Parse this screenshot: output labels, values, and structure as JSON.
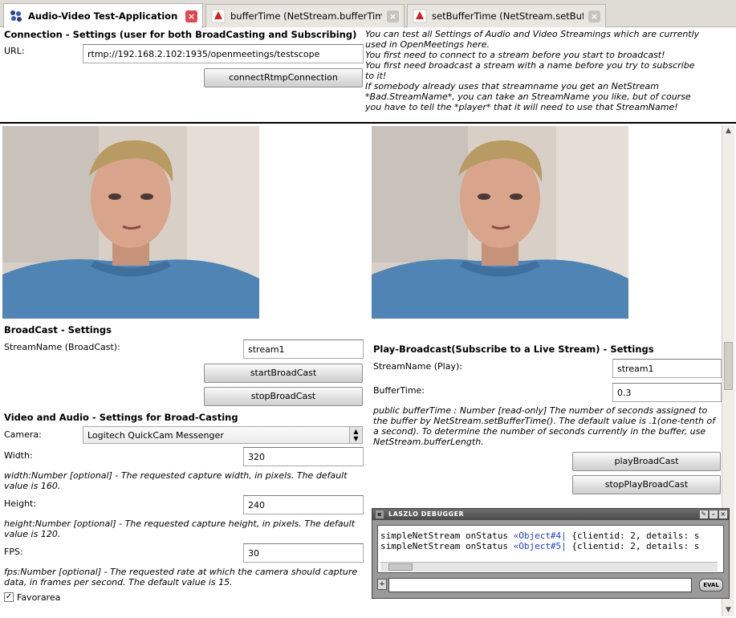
{
  "tabs": [
    {
      "label": "Audio-Video Test-Application",
      "close": "×",
      "active": true
    },
    {
      "label": "bufferTime (NetStream.bufferTime pr...",
      "close": "×",
      "active": false
    },
    {
      "label": "setBufferTime (NetStream.setBufferTi...",
      "close": "×",
      "active": false
    }
  ],
  "connection": {
    "title": "Connection - Settings (user for both BroadCasting and Subscribing)",
    "url_label": "URL:",
    "url_value": "rtmp://192.168.2.102:1935/openmeetings/testscope",
    "connect_button": "connectRtmpConnection"
  },
  "info_lines": [
    "You can test all Settings of Audio and Video Streamings which are currently",
    "used in OpenMeetings here.",
    "You first need to connect to a stream before you start to broadcast!",
    "You first need broadcast a stream with a name before you try to subscribe",
    "to it!",
    "If somebody already uses that streamname you get an NetStream",
    "*Bad.StreamName*, you can take an StreamName you like, but of course",
    "you have to tell the *player* that it will need to use that StreamName!"
  ],
  "broadcast": {
    "title": "BroadCast - Settings",
    "stream_label": "StreamName (BroadCast):",
    "stream_value": "stream1",
    "start_button": "startBroadCast",
    "stop_button": "stopBroadCast"
  },
  "video_audio": {
    "title": "Video and Audio - Settings for Broad-Casting",
    "camera_label": "Camera:",
    "camera_value": "Logitech QuickCam Messenger",
    "width_label": "Width:",
    "width_value": "320",
    "width_help": "width:Number [optional] - The requested capture width, in pixels. The default value is 160.",
    "height_label": "Height:",
    "height_value": "240",
    "height_help": "height:Number [optional] - The requested capture height, in pixels. The default value is 120.",
    "fps_label": "FPS:",
    "fps_value": "30",
    "fps_help": "fps:Number [optional] - The requested rate at which the camera should capture data, in frames per second. The default value is 15.",
    "favorarea_label": "Favorarea",
    "favorarea_checked": true
  },
  "play": {
    "title": "Play-Broadcast(Subscribe to a Live Stream) - Settings",
    "stream_label": "StreamName (Play):",
    "stream_value": "stream1",
    "buffer_label": "BufferTime:",
    "buffer_value": "0.3",
    "buffer_help": "public bufferTime : Number [read-only] The number of seconds assigned to the buffer by NetStream.setBufferTime(). The default value is .1(one-tenth of a second). To determine the number of seconds currently in the buffer, use NetStream.bufferLength.",
    "play_button": "playBroadCast",
    "stop_button": "stopPlayBroadCast"
  },
  "debugger": {
    "title": "LASZLO DEBUGGER",
    "line1_prefix": "simpleNetStream onStatus ",
    "line1_obj": "«Object#4|",
    "line1_rest": " {clientid: 2, details: s",
    "line2_prefix": "simpleNetStream onStatus ",
    "line2_obj": "«Object#5|",
    "line2_rest": " {clientid: 2, details: s",
    "eval_button": "EVAL"
  }
}
